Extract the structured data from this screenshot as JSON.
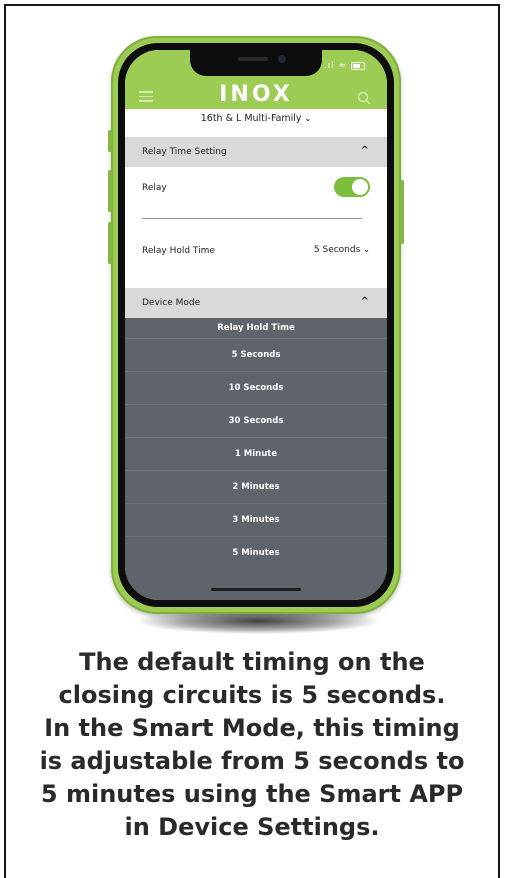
{
  "app": {
    "logo_text": "INOX",
    "location_label": "16th & L Multi-Family",
    "location_chevron": "❯",
    "accent_color": "#9ccc53"
  },
  "relay_section": {
    "title": "Relay Time Setting",
    "caret": "^",
    "relay_label": "Relay",
    "relay_enabled": true,
    "hold_time_label": "Relay Hold Time",
    "hold_time_value": "5 Seconds"
  },
  "device_mode_section": {
    "title": "Device Mode",
    "caret": "^"
  },
  "picker": {
    "title": "Relay Hold Time",
    "options": [
      "5 Seconds",
      "10 Seconds",
      "30 Seconds",
      "1 Minute",
      "2 Minutes",
      "3 Minutes",
      "5 Minutes"
    ]
  },
  "caption": {
    "lines": [
      "The default timing on the",
      "closing circuits is 5 seconds.",
      "In the Smart Mode, this timing",
      "is adjustable from 5 seconds to",
      "5 minutes using the Smart APP",
      "in Device Settings."
    ]
  },
  "icons": [
    "menu-icon",
    "search-icon",
    "chevron-down-icon",
    "caret-up-icon",
    "wifi-icon",
    "battery-icon",
    "signal-icon"
  ]
}
